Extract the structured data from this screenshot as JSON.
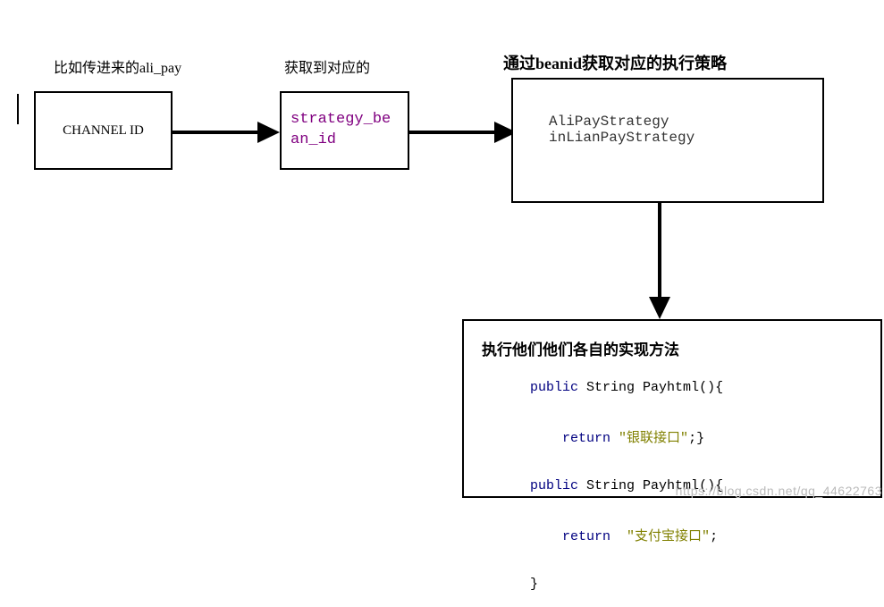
{
  "labels": {
    "box1_caption": "比如传进来的ali_pay",
    "box2_caption": "获取到对应的",
    "box3_caption": "通过beanid获取对应的执行策略"
  },
  "box1": {
    "text": "CHANNEL ID"
  },
  "box2": {
    "text": "strategy_bean_id"
  },
  "box3": {
    "line1": "AliPayStrategy",
    "line2": "inLianPayStrategy"
  },
  "box4": {
    "title": "执行他们他们各自的实现方法",
    "code": {
      "l1_kw": "public",
      "l1_type": " String ",
      "l1_name": "Payhtml",
      "l1_rest": "(){",
      "l2_kw": "    return ",
      "l2_str": "\"银联接口\"",
      "l2_rest": ";}",
      "l3_kw": "public",
      "l3_type": " String ",
      "l3_name": "Payhtml",
      "l3_rest": "(){",
      "l4_kw": "    return  ",
      "l4_str": "\"支付宝接口\"",
      "l4_rest": ";",
      "l5": "}"
    }
  },
  "watermark": "https://blog.csdn.net/qq_44622763"
}
